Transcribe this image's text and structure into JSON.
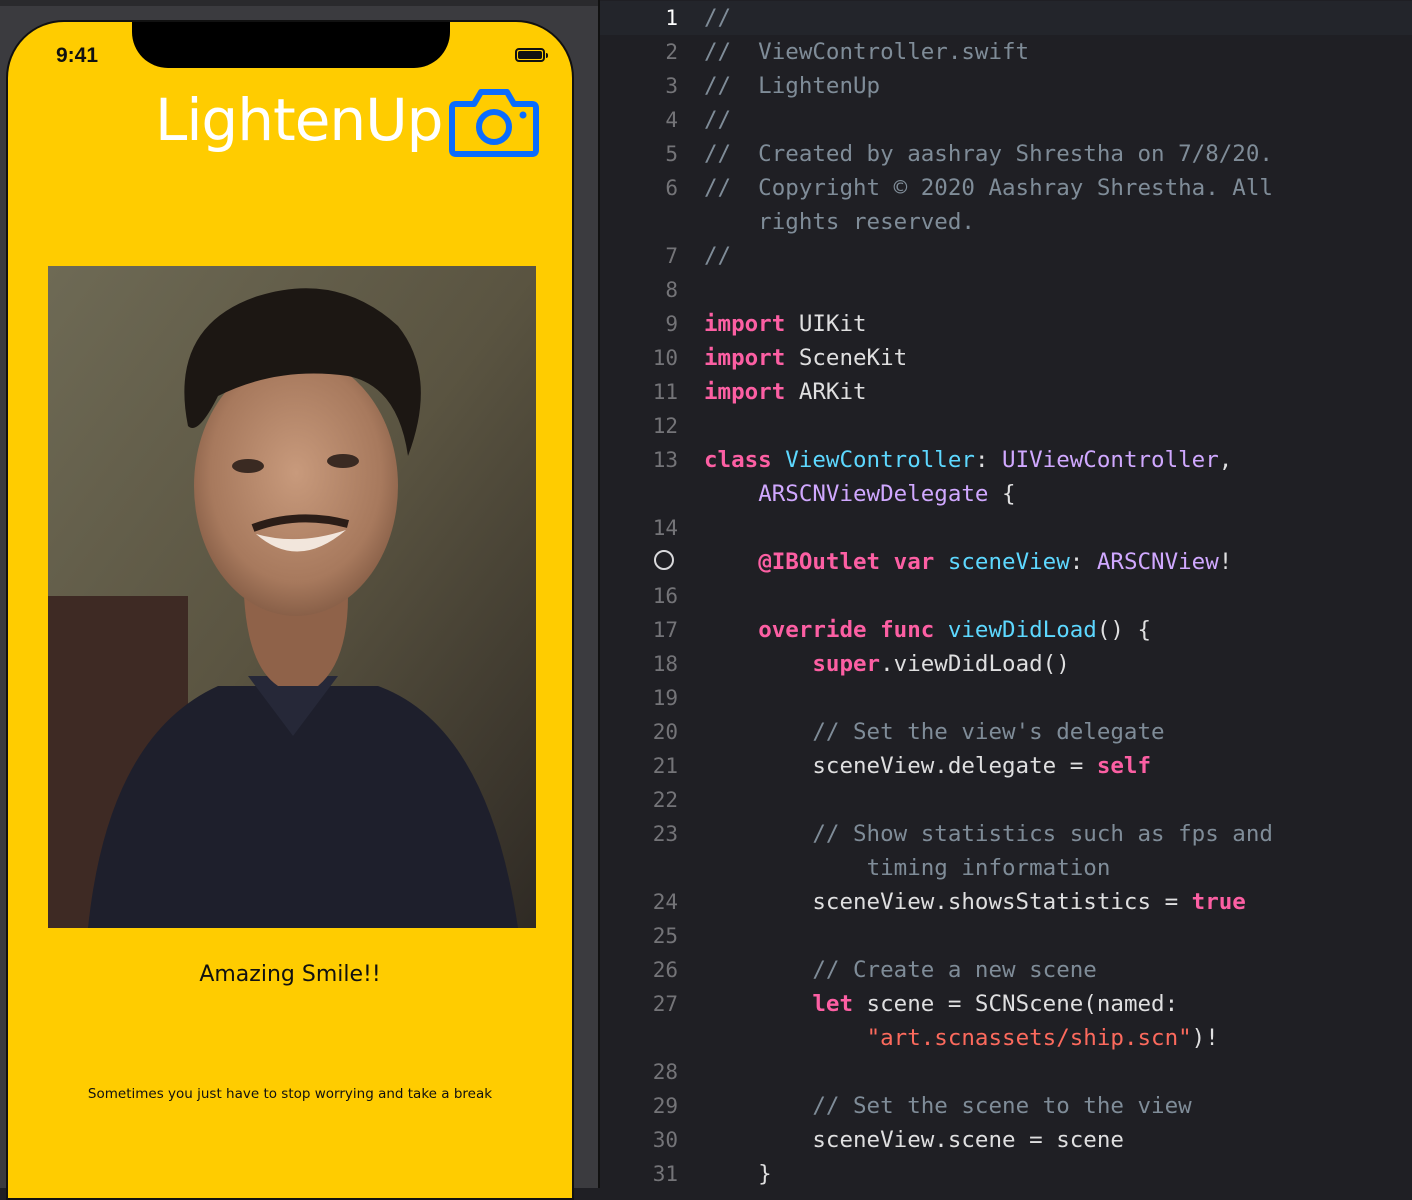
{
  "simulator": {
    "status_time": "9:41",
    "app_title": "LightenUp",
    "photo_caption": "Amazing Smile!!",
    "quote": "Sometimes you just have to stop worrying and take a break",
    "colors": {
      "background": "#ffcc00",
      "camera_icon": "#0a6cff",
      "title": "#ffffff"
    },
    "icons": {
      "camera": "camera-icon",
      "battery": "battery-icon"
    }
  },
  "editor": {
    "current_line": "1",
    "lines": [
      {
        "n": "1",
        "parts": [
          {
            "c": "comment",
            "t": "//"
          }
        ]
      },
      {
        "n": "2",
        "parts": [
          {
            "c": "comment",
            "t": "//  ViewController.swift"
          }
        ]
      },
      {
        "n": "3",
        "parts": [
          {
            "c": "comment",
            "t": "//  LightenUp"
          }
        ]
      },
      {
        "n": "4",
        "parts": [
          {
            "c": "comment",
            "t": "//"
          }
        ]
      },
      {
        "n": "5",
        "parts": [
          {
            "c": "comment",
            "t": "//  Created by aashray Shrestha on 7/8/20."
          }
        ]
      },
      {
        "n": "6",
        "parts": [
          {
            "c": "comment",
            "t": "//  Copyright © 2020 Aashray Shrestha. All"
          }
        ],
        "cont": [
          {
            "c": "comment",
            "t": "    rights reserved."
          }
        ]
      },
      {
        "n": "7",
        "parts": [
          {
            "c": "comment",
            "t": "//"
          }
        ]
      },
      {
        "n": "8",
        "parts": []
      },
      {
        "n": "9",
        "parts": [
          {
            "c": "kw",
            "t": "import"
          },
          {
            "c": "",
            "t": " UIKit"
          }
        ]
      },
      {
        "n": "10",
        "parts": [
          {
            "c": "kw",
            "t": "import"
          },
          {
            "c": "",
            "t": " SceneKit"
          }
        ]
      },
      {
        "n": "11",
        "parts": [
          {
            "c": "kw",
            "t": "import"
          },
          {
            "c": "",
            "t": " ARKit"
          }
        ]
      },
      {
        "n": "12",
        "parts": []
      },
      {
        "n": "13",
        "parts": [
          {
            "c": "kw",
            "t": "class"
          },
          {
            "c": "",
            "t": " "
          },
          {
            "c": "decl",
            "t": "ViewController"
          },
          {
            "c": "",
            "t": ": "
          },
          {
            "c": "type",
            "t": "UIViewController"
          },
          {
            "c": "",
            "t": ","
          }
        ],
        "cont": [
          {
            "c": "",
            "t": "    "
          },
          {
            "c": "type",
            "t": "ARSCNViewDelegate"
          },
          {
            "c": "",
            "t": " {"
          }
        ]
      },
      {
        "n": "14",
        "parts": []
      },
      {
        "n": "",
        "parts": [
          {
            "c": "",
            "t": "    "
          },
          {
            "c": "attr",
            "t": "@IBOutlet"
          },
          {
            "c": "",
            "t": " "
          },
          {
            "c": "kw",
            "t": "var"
          },
          {
            "c": "",
            "t": " "
          },
          {
            "c": "decl",
            "t": "sceneView"
          },
          {
            "c": "",
            "t": ": "
          },
          {
            "c": "type",
            "t": "ARSCNView"
          },
          {
            "c": "",
            "t": "!"
          }
        ]
      },
      {
        "n": "16",
        "parts": []
      },
      {
        "n": "17",
        "parts": [
          {
            "c": "",
            "t": "    "
          },
          {
            "c": "kw",
            "t": "override"
          },
          {
            "c": "",
            "t": " "
          },
          {
            "c": "kw",
            "t": "func"
          },
          {
            "c": "",
            "t": " "
          },
          {
            "c": "decl",
            "t": "viewDidLoad"
          },
          {
            "c": "",
            "t": "() {"
          }
        ]
      },
      {
        "n": "18",
        "parts": [
          {
            "c": "",
            "t": "        "
          },
          {
            "c": "kw",
            "t": "super"
          },
          {
            "c": "",
            "t": ".viewDidLoad()"
          }
        ]
      },
      {
        "n": "19",
        "parts": []
      },
      {
        "n": "20",
        "parts": [
          {
            "c": "",
            "t": "        "
          },
          {
            "c": "comment",
            "t": "// Set the view's delegate"
          }
        ]
      },
      {
        "n": "21",
        "parts": [
          {
            "c": "",
            "t": "        sceneView.delegate = "
          },
          {
            "c": "kw",
            "t": "self"
          }
        ]
      },
      {
        "n": "22",
        "parts": []
      },
      {
        "n": "23",
        "parts": [
          {
            "c": "",
            "t": "        "
          },
          {
            "c": "comment",
            "t": "// Show statistics such as fps and"
          }
        ],
        "cont": [
          {
            "c": "",
            "t": "            "
          },
          {
            "c": "comment",
            "t": "timing information"
          }
        ]
      },
      {
        "n": "24",
        "parts": [
          {
            "c": "",
            "t": "        sceneView.showsStatistics = "
          },
          {
            "c": "kw",
            "t": "true"
          }
        ]
      },
      {
        "n": "25",
        "parts": []
      },
      {
        "n": "26",
        "parts": [
          {
            "c": "",
            "t": "        "
          },
          {
            "c": "comment",
            "t": "// Create a new scene"
          }
        ]
      },
      {
        "n": "27",
        "parts": [
          {
            "c": "",
            "t": "        "
          },
          {
            "c": "kw",
            "t": "let"
          },
          {
            "c": "",
            "t": " scene = SCNScene(named:"
          }
        ],
        "cont": [
          {
            "c": "",
            "t": "            "
          },
          {
            "c": "str",
            "t": "\"art.scnassets/ship.scn\""
          },
          {
            "c": "",
            "t": ")!"
          }
        ]
      },
      {
        "n": "28",
        "parts": []
      },
      {
        "n": "29",
        "parts": [
          {
            "c": "",
            "t": "        "
          },
          {
            "c": "comment",
            "t": "// Set the scene to the view"
          }
        ]
      },
      {
        "n": "30",
        "parts": [
          {
            "c": "",
            "t": "        sceneView.scene = scene"
          }
        ]
      },
      {
        "n": "31",
        "parts": [
          {
            "c": "",
            "t": "    }"
          }
        ]
      }
    ]
  }
}
